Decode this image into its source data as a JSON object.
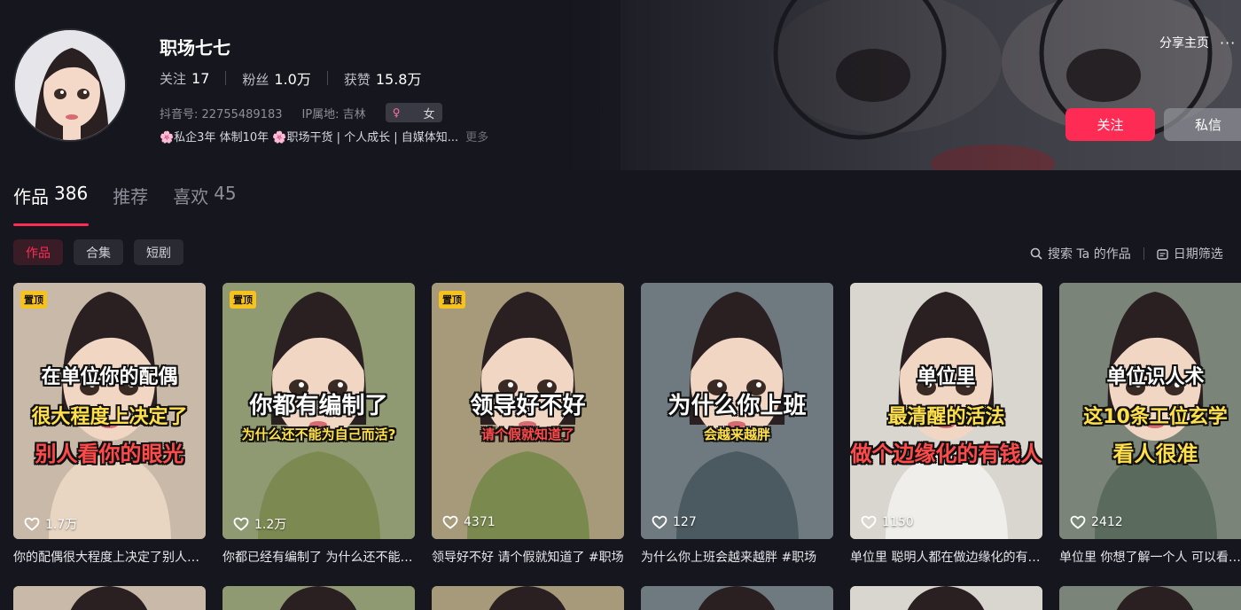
{
  "profile": {
    "name": "职场七七",
    "stats": [
      {
        "label": "关注",
        "value": "17"
      },
      {
        "label": "粉丝",
        "value": "1.0万"
      },
      {
        "label": "获赞",
        "value": "15.8万"
      }
    ],
    "douyin_id": "抖音号: 22755489183",
    "ip": "IP属地: 吉林",
    "gender": "女",
    "bio": "🌸私企3年 体制10年 🌸职场干货 | 个人成长 | 自媒体知...",
    "more": "更多"
  },
  "actions": {
    "share": "分享主页",
    "more_dots": "···",
    "follow": "关注",
    "message": "私信"
  },
  "tabs": [
    {
      "label": "作品",
      "count": "386"
    },
    {
      "label": "推荐",
      "count": ""
    },
    {
      "label": "喜欢",
      "count": "45"
    }
  ],
  "chips": [
    "作品",
    "合集",
    "短剧"
  ],
  "tools": {
    "search": "搜索 Ta 的作品",
    "date_filter": "日期筛选"
  },
  "colors": {
    "accent": "#fe2c55",
    "pin": "#f7c21b",
    "caption_white": "#ffffff",
    "caption_yellow": "#ffe04a",
    "caption_red": "#ff4a4a"
  },
  "videos": [
    {
      "pinned": true,
      "pin_label": "置顶",
      "captions": [
        {
          "text": "在单位你的配偶",
          "color": "#ffffff"
        },
        {
          "text": "很大程度上决定了",
          "color": "#ffe04a"
        },
        {
          "text": "别人看你的眼光",
          "color": "#ff4a4a"
        }
      ],
      "likes": "1.7万",
      "title": "你的配偶很大程度上决定了别人看你的眼光"
    },
    {
      "pinned": true,
      "pin_label": "置顶",
      "captions": [
        {
          "text": "你都有编制了",
          "color": "#ffffff"
        },
        {
          "text": "为什么还不能为自己而活?",
          "color": "#ffe04a"
        }
      ],
      "likes": "1.2万",
      "title": "你都已经有编制了 为什么还不能为自己而活"
    },
    {
      "pinned": true,
      "pin_label": "置顶",
      "captions": [
        {
          "text": "领导好不好",
          "color": "#ffffff"
        },
        {
          "text": "请个假就知道了",
          "color": "#ff4a4a"
        }
      ],
      "likes": "4371",
      "title": "领导好不好 请个假就知道了 #职场"
    },
    {
      "pinned": false,
      "pin_label": "",
      "captions": [
        {
          "text": "为什么你上班",
          "color": "#ffffff"
        },
        {
          "text": "会越来越胖",
          "color": "#ffe04a"
        }
      ],
      "likes": "127",
      "title": "为什么你上班会越来越胖 #职场"
    },
    {
      "pinned": false,
      "pin_label": "",
      "captions": [
        {
          "text": "单位里",
          "color": "#ffffff"
        },
        {
          "text": "最清醒的活法",
          "color": "#ffe04a"
        },
        {
          "text": "做个边缘化的有钱人",
          "color": "#ff4a4a"
        }
      ],
      "likes": "1150",
      "title": "单位里 聪明人都在做边缘化的有钱人"
    },
    {
      "pinned": false,
      "pin_label": "",
      "captions": [
        {
          "text": "单位识人术",
          "color": "#ffffff"
        },
        {
          "text": "这10条工位玄学",
          "color": "#ffe04a"
        },
        {
          "text": "看人很准",
          "color": "#ffe04a"
        }
      ],
      "likes": "2412",
      "title": "单位里 你想了解一个人 可以看看他的工位"
    }
  ]
}
